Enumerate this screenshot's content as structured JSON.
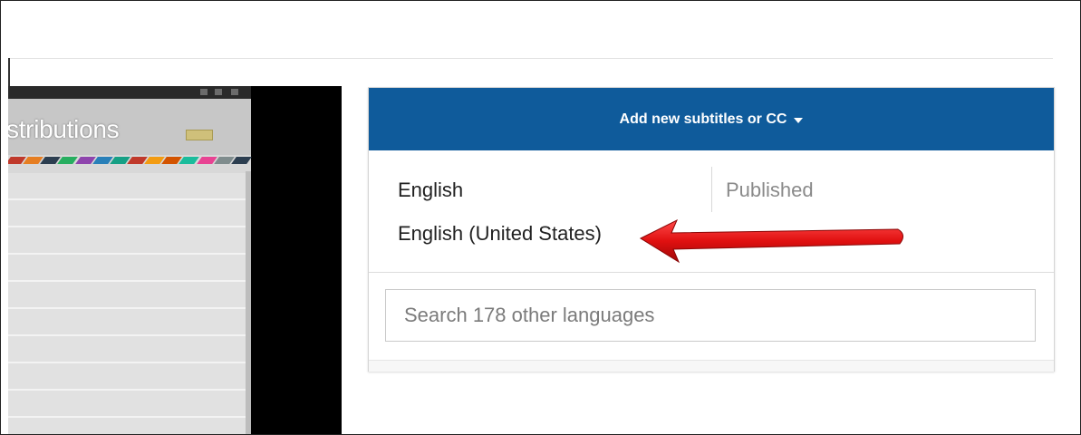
{
  "video": {
    "title_fragment": "stributions",
    "strip_colors": [
      "#c0392b",
      "#e67e22",
      "#2c3e50",
      "#27ae60",
      "#8e44ad",
      "#2980b9",
      "#16a085",
      "#c0392b",
      "#f39c12",
      "#d35400",
      "#1abc9c",
      "#e84393",
      "#7f8c8d",
      "#2c3e50"
    ]
  },
  "panel": {
    "add_button_label": "Add new subtitles or CC",
    "languages": [
      {
        "name": "English",
        "status": "Published"
      },
      {
        "name": "English (United States)",
        "status": ""
      }
    ],
    "search_placeholder": "Search 178 other languages"
  },
  "colors": {
    "header_blue": "#0f5b9b",
    "arrow_red": "#e01010"
  }
}
